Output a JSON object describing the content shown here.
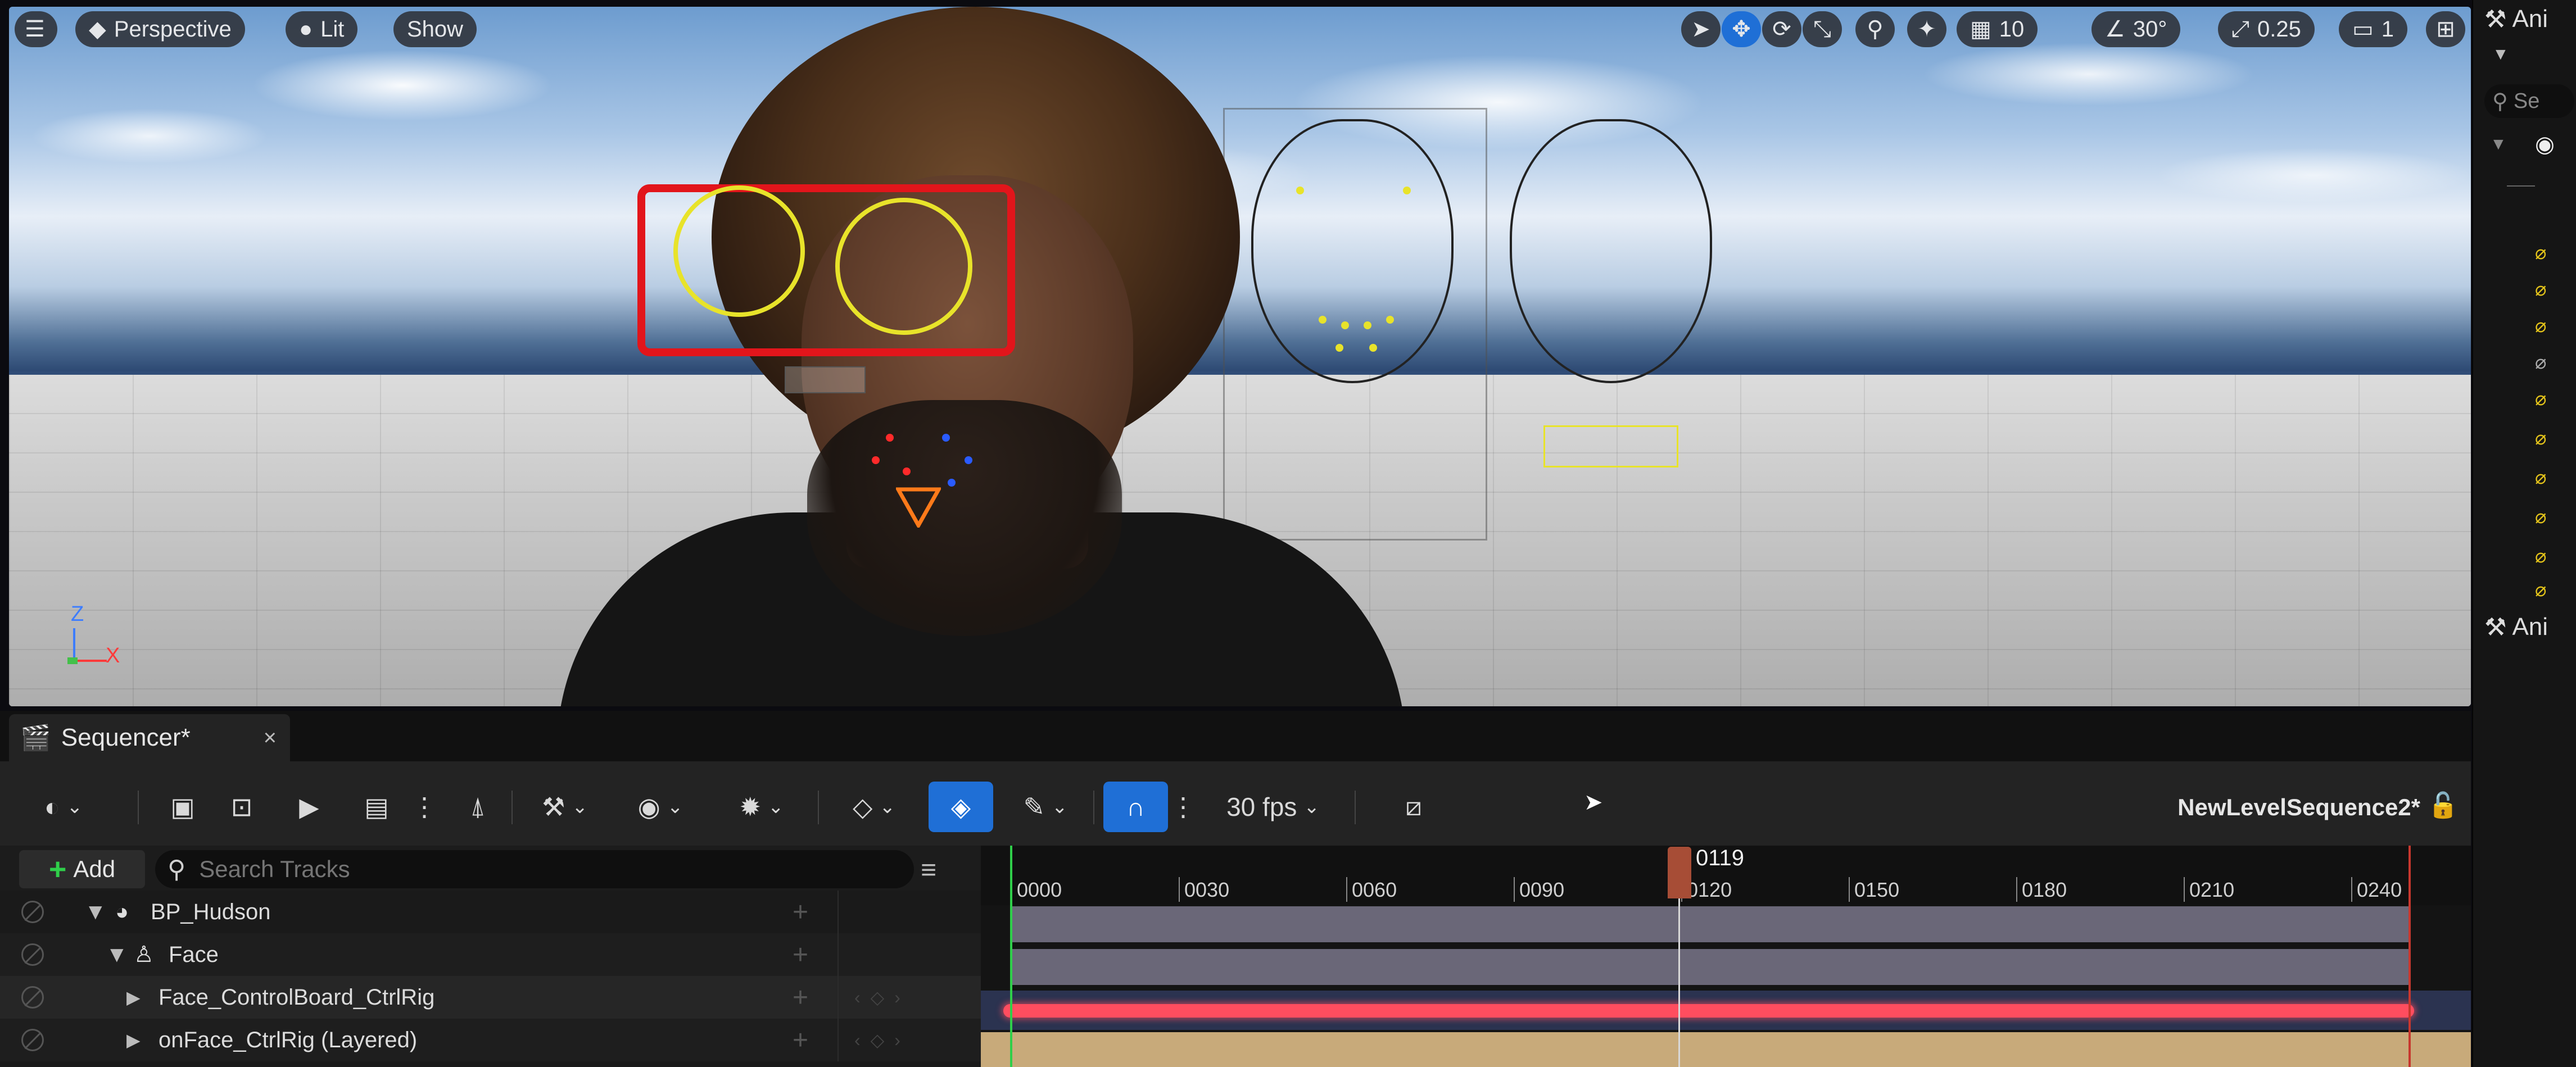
{
  "viewport": {
    "menu_icon": "hamburger-icon",
    "perspective_label": "Perspective",
    "lit_label": "Lit",
    "show_label": "Show",
    "grid_snap_value": "10",
    "rotation_snap_value": "30°",
    "scale_snap_value": "0.25",
    "camera_speed_value": "1"
  },
  "right_panel": {
    "tab_top_label": "Ani",
    "search_placeholder": "Se",
    "tab_bottom_label": "Ani"
  },
  "sequencer": {
    "tab_label": "Sequencer*",
    "close_symbol": "×",
    "fps_label": "30 fps",
    "sequence_name": "NewLevelSequence2*",
    "add_label": "Add",
    "search_placeholder": "Search Tracks",
    "tracks": [
      {
        "label": "BP_Hudson",
        "icon": "actor-icon"
      },
      {
        "label": "Face",
        "icon": "skeleton-icon"
      },
      {
        "label": "Face_ControlBoard_CtrlRig",
        "icon": ""
      },
      {
        "label": "onFace_CtrlRig (Layered)",
        "icon": ""
      }
    ],
    "ruler_labels": [
      "0000",
      "0030",
      "0060",
      "0090",
      "0120",
      "0150",
      "0180",
      "0210",
      "0240"
    ],
    "current_frame": "0119"
  },
  "colors": {
    "accent_blue": "#1f6fd6",
    "rig_red": "#e2151b",
    "rig_yellow": "#e8e32a",
    "control_rig_track": "#ff4d5f",
    "layered_track": "#c8aa7a",
    "section_track": "#6a6778"
  }
}
